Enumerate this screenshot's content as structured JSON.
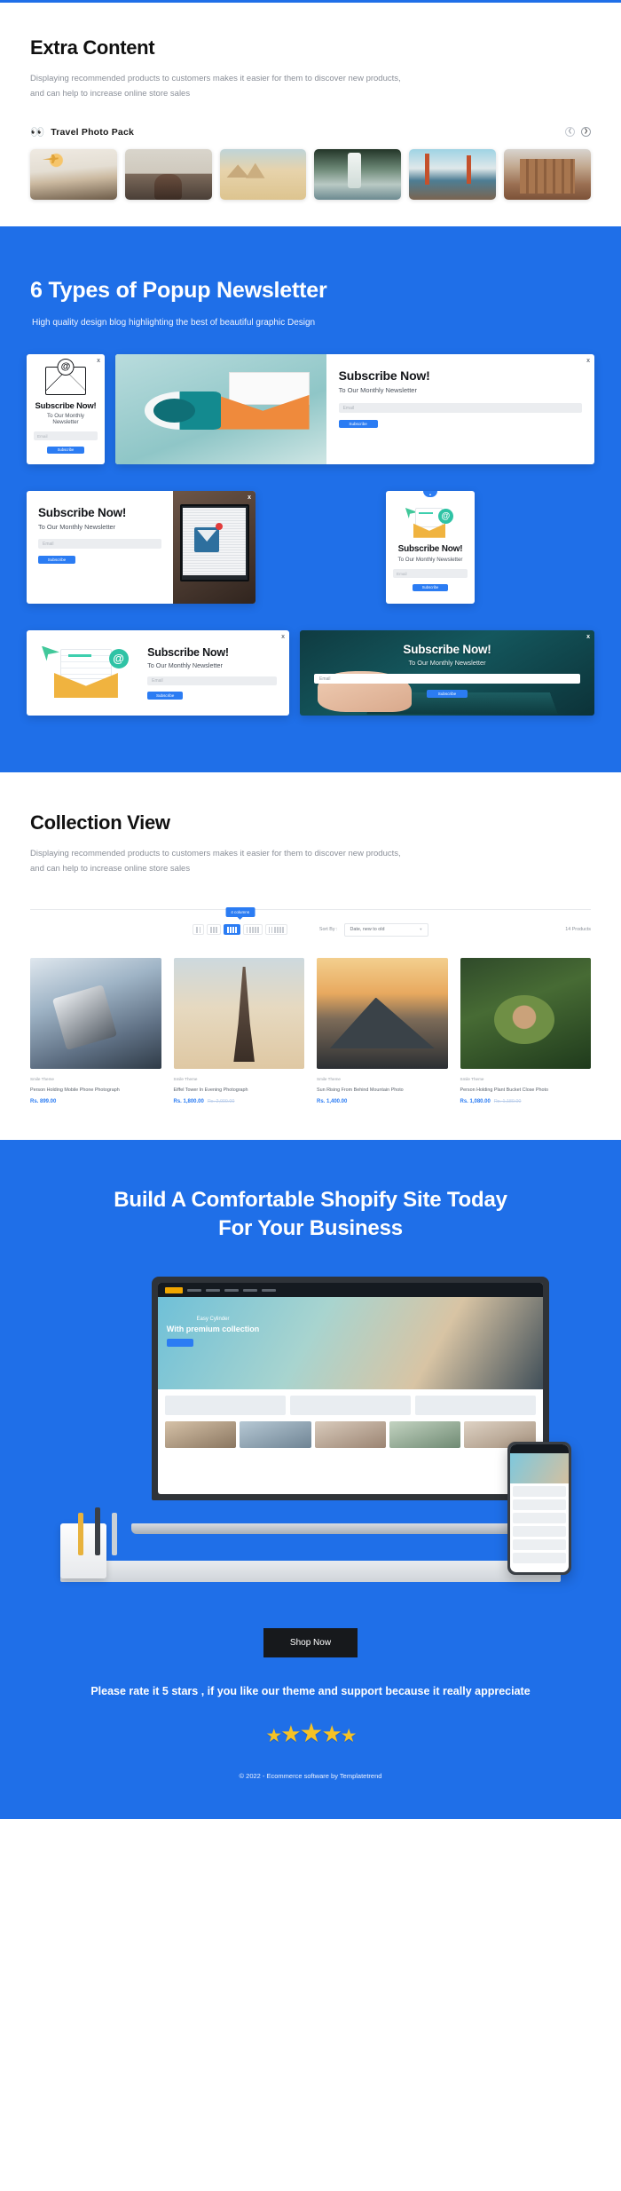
{
  "theme": {
    "accent": "#1f6fe8",
    "button_blue": "#2b7cf3",
    "dark": "#17191c",
    "star": "#f5c225"
  },
  "extra": {
    "title": "Extra Content",
    "description": "Displaying recommended products to customers makes it easier for them to discover new products, and can help to increase online store sales",
    "pack": {
      "emoji": "👀",
      "title": "Travel Photo Pack",
      "prev_icon": "chevron-left-icon",
      "next_icon": "chevron-right-icon",
      "items": [
        {
          "alt": "Person relaxing at airport with plane"
        },
        {
          "alt": "Woman facing palace building"
        },
        {
          "alt": "Camel rider at the pyramids"
        },
        {
          "alt": "Person standing before a waterfall"
        },
        {
          "alt": "Golden Gate Bridge"
        },
        {
          "alt": "Ancient stone ruins"
        }
      ]
    }
  },
  "popups": {
    "title": "6 Types of Popup Newsletter",
    "subtitle": "High quality design blog highlighting the best of beautiful graphic Design",
    "close_label": "x",
    "common": {
      "heading": "Subscribe Now!",
      "subheading": "To Our Monthly Newsletter",
      "email_placeholder": "Email",
      "button": "Subscribe"
    },
    "cards": [
      {
        "id": "popup-1",
        "art": "at-envelope-line-icon"
      },
      {
        "id": "popup-2",
        "art": "megaphone-mail-illustration"
      },
      {
        "id": "popup-3",
        "art": "laptop-inbox-photo"
      },
      {
        "id": "popup-4",
        "art": "open-envelope-illustration"
      },
      {
        "id": "popup-5",
        "art": "open-envelope-illustration"
      },
      {
        "id": "popup-6",
        "art": "hands-on-laptop-photo"
      }
    ]
  },
  "collection": {
    "title": "Collection View",
    "description": "Displaying recommended products to customers makes it easier for them to discover new products, and can help to increase online store sales",
    "tooltip": "4 columns",
    "columns_options": [
      2,
      3,
      4,
      5,
      6
    ],
    "columns_active": 4,
    "sort_label": "Sort By :",
    "sort_value": "Date, new to old",
    "product_count": "14 Products",
    "products": [
      {
        "vendor": "Smile Theme",
        "title": "Person Holding Mobile Phone Photograph",
        "price": "Rs. 899.00",
        "compare_at": ""
      },
      {
        "vendor": "Smile Theme",
        "title": "Eiffel Tower In Evening Photograph",
        "price": "Rs. 1,800.00",
        "compare_at": "Rs. 2,000.00"
      },
      {
        "vendor": "Smile Theme",
        "title": "Sun Rising From Behind Mountain Photo",
        "price": "Rs. 1,400.00",
        "compare_at": ""
      },
      {
        "vendor": "Smile Theme",
        "title": "Person Holding Plant Bucket Close Photo",
        "price": "Rs. 1,080.00",
        "compare_at": "Rs. 1,180.00"
      }
    ]
  },
  "cta": {
    "heading_line1": "Build A Comfortable Shopify Site Today",
    "heading_line2": "For Your Business",
    "shop_button": "Shop Now",
    "rate_text": "Please rate it 5 stars , if you like our theme and support because it really appreciate",
    "stars": "★★★★★",
    "copyright": "© 2022 - Ecommerce software by Templatetrend",
    "mockup": {
      "hero_small": "Easy Cylinder",
      "hero_big": "With premium collection",
      "hero_button": ""
    }
  }
}
